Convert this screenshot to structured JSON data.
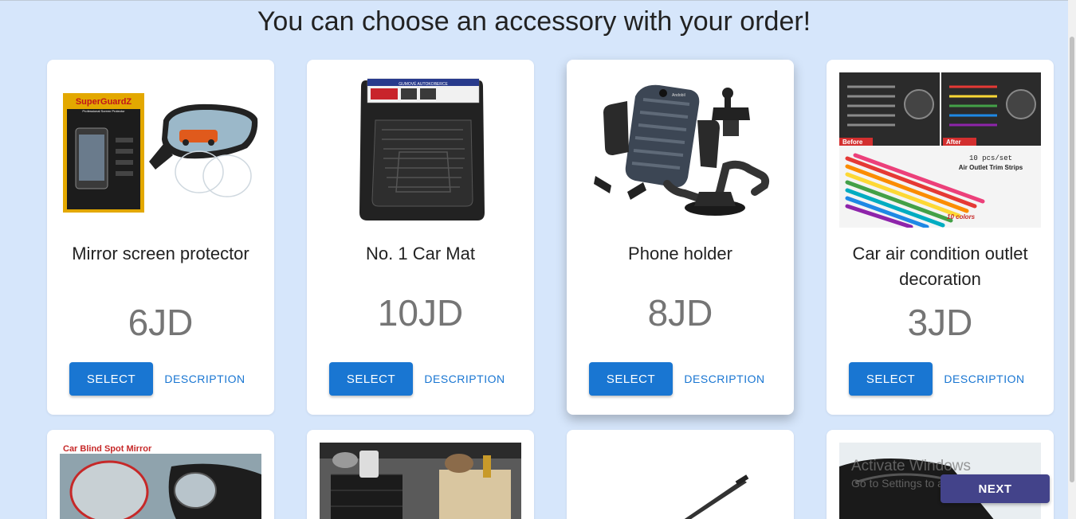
{
  "page": {
    "title": "You can choose an accessory with your order!"
  },
  "products": [
    {
      "name": "Mirror screen protector",
      "price": "6JD",
      "select_label": "SELECT",
      "description_label": "DESCRIPTION"
    },
    {
      "name": "No. 1 Car Mat",
      "price": "10JD",
      "select_label": "SELECT",
      "description_label": "DESCRIPTION"
    },
    {
      "name": "Phone holder",
      "price": "8JD",
      "select_label": "SELECT",
      "description_label": "DESCRIPTION"
    },
    {
      "name": "Car air condition outlet decoration",
      "price": "3JD",
      "select_label": "SELECT",
      "description_label": "DESCRIPTION"
    }
  ],
  "images": {
    "mirror_brand": "SuperGuardZ",
    "mirror_brand_sub": "Professional Screen Protector",
    "car_mat_brand": "GUMOVÉ AUTOKOBERCE",
    "phone_brand": "Andobil",
    "air_before": "Before",
    "air_after": "After",
    "air_set": "10 pcs/set",
    "air_desc": "Air Outlet Trim Strips",
    "air_colors": "10 colors",
    "blind_spot_title": "Car Blind Spot Mirror"
  },
  "footer": {
    "next_label": "NEXT"
  },
  "watermark": {
    "line1": "Activate Windows",
    "line2": "Go to Settings to activate Windows."
  },
  "colors": {
    "background": "#d6e6fb",
    "primary": "#1976d2",
    "next_button": "#43438a",
    "price": "#757575"
  }
}
